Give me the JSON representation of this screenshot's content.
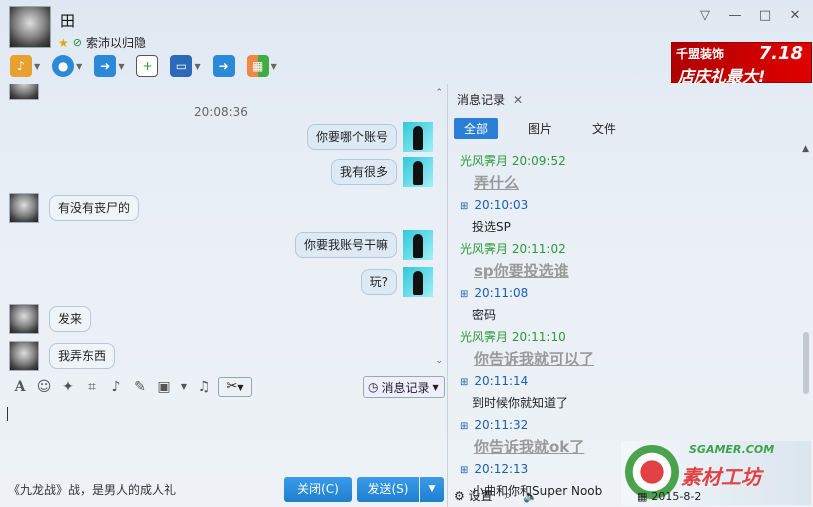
{
  "contact": {
    "name": "田",
    "signature": "索沛以归隐"
  },
  "window_controls": {
    "menu": "▽",
    "minimize": "—",
    "maximize": "□",
    "close": "✕"
  },
  "ad": {
    "brand": "千盟装饰",
    "date": "7.18",
    "slogan": "店庆礼最大!"
  },
  "chat": {
    "timestamp": "20:08:36",
    "messages": [
      {
        "from": "me",
        "text": "你要哪个账号"
      },
      {
        "from": "me",
        "text": "我有很多"
      },
      {
        "from": "other",
        "text": "有没有丧尸的"
      },
      {
        "from": "me",
        "text": "你要我账号干嘛"
      },
      {
        "from": "me",
        "text": "玩?"
      },
      {
        "from": "other",
        "text": "发来"
      },
      {
        "from": "other",
        "text": "我弄东西"
      }
    ]
  },
  "compose": {
    "history_button": "消息记录",
    "footer_text": "《九龙战》战，是男人的成人礼",
    "close_button": "关闭(C)",
    "send_button": "发送(S)"
  },
  "history": {
    "tab_title": "消息记录",
    "filters": [
      "全部",
      "图片",
      "文件"
    ],
    "active_filter": "全部",
    "entries": [
      {
        "kind": "other",
        "text": "光风霁月 20:09:52"
      },
      {
        "kind": "big",
        "text": "弄什么"
      },
      {
        "kind": "mine",
        "text": "20:10:03"
      },
      {
        "kind": "plain",
        "text": "投选SP"
      },
      {
        "kind": "other",
        "text": "光风霁月 20:11:02"
      },
      {
        "kind": "big",
        "text": "sp你要投选谁"
      },
      {
        "kind": "mine",
        "text": "20:11:08"
      },
      {
        "kind": "plain",
        "text": "密码"
      },
      {
        "kind": "other",
        "text": "光风霁月 20:11:10"
      },
      {
        "kind": "big",
        "text": "你告诉我就可以了"
      },
      {
        "kind": "mine",
        "text": "20:11:14"
      },
      {
        "kind": "plain",
        "text": "到时候你就知道了"
      },
      {
        "kind": "mine",
        "text": "20:11:32"
      },
      {
        "kind": "big",
        "text": "你告诉我就ok了"
      },
      {
        "kind": "mine",
        "text": "20:12:13"
      },
      {
        "kind": "plain",
        "text": "小曲和你和Super Noob"
      }
    ],
    "settings_label": "设置"
  },
  "logo": {
    "site": "SGAMER.COM",
    "brand": "素材工坊"
  },
  "date": "2015-8-2",
  "colors": {
    "accent": "#2b7ed6",
    "other_name": "#2a9a3a",
    "mine_time": "#1a5fb0"
  }
}
